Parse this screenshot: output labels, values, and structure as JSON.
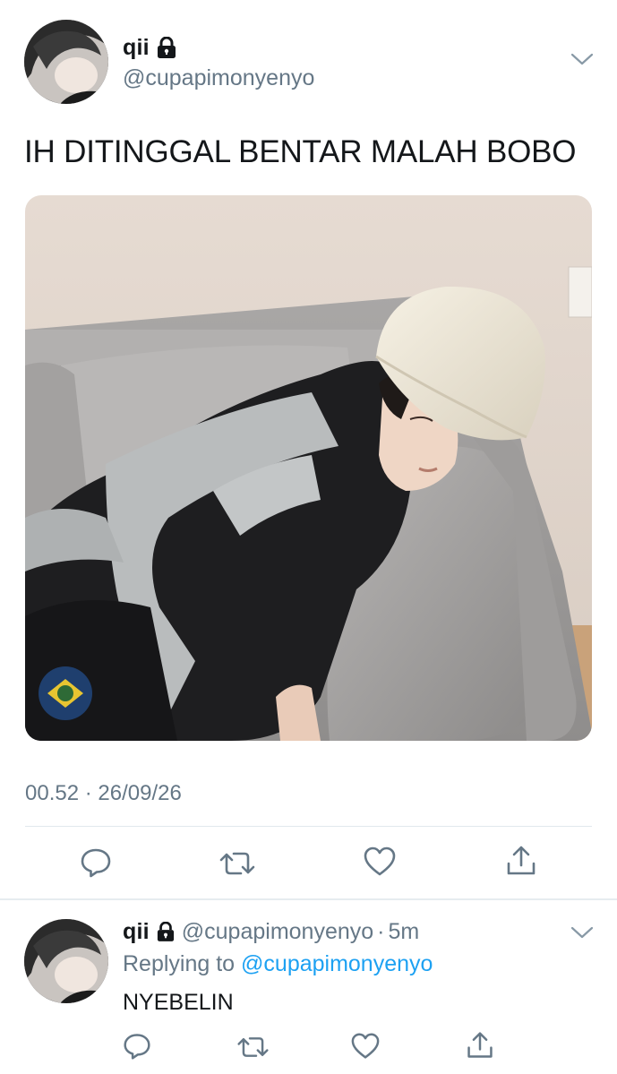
{
  "tweet": {
    "author_name": "qii",
    "author_handle": "@cupapimonyenyo",
    "text": "IH DITINGGAL BENTAR MALAH BOBO",
    "timestamp": "00.52 · 26/09/26",
    "avatar_icon": "profile-photo",
    "locked_icon": "lock-icon",
    "menu_icon": "chevron-down-icon",
    "actions": [
      {
        "name": "reply",
        "icon": "comment-icon"
      },
      {
        "name": "retweet",
        "icon": "retweet-icon"
      },
      {
        "name": "like",
        "icon": "heart-icon"
      },
      {
        "name": "share",
        "icon": "share-icon"
      }
    ]
  },
  "reply": {
    "author_name": "qii",
    "author_handle": "@cupapimonyenyo",
    "separator": "·",
    "time": "5m",
    "replying_prefix": "Replying to",
    "replying_to": "@cupapimonyenyo",
    "text": "NYEBELIN"
  },
  "colors": {
    "text": "#14171a",
    "secondary": "#657786",
    "link": "#1da1f2",
    "divider": "#e1e8ed"
  }
}
